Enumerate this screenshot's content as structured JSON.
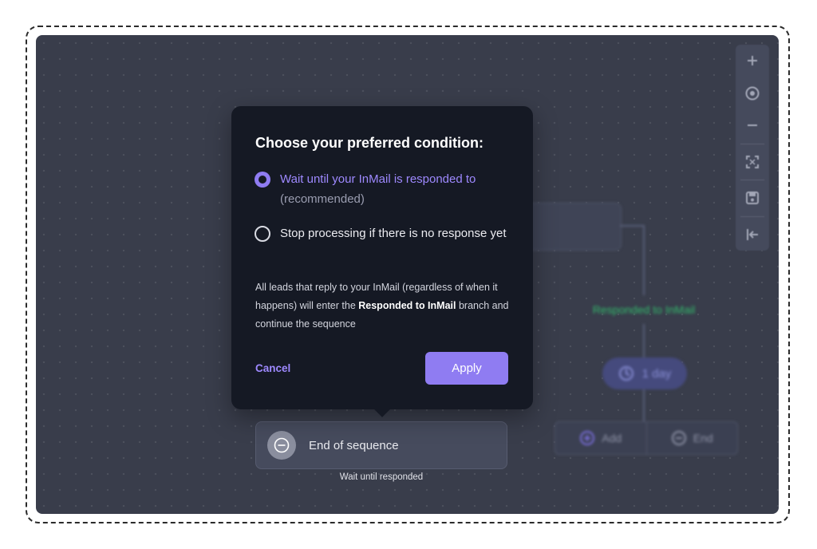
{
  "popover": {
    "title": "Choose your preferred condition:",
    "options": [
      {
        "label": "Wait until your InMail is responded to",
        "sublabel": "(recommended)",
        "selected": true
      },
      {
        "label": "Stop processing if there is no response yet",
        "selected": false
      }
    ],
    "description_pre": "All leads that reply to your InMail (regardless of when it happens) will enter the ",
    "description_bold": "Responded to InMail",
    "description_post": " branch and continue the sequence",
    "cancel_label": "Cancel",
    "apply_label": "Apply"
  },
  "workflow": {
    "end_node_label": "End of sequence",
    "end_node_caption": "Wait until responded",
    "branch_label": "Responded to InMail",
    "delay_label": "1 day",
    "add_label": "Add",
    "end_label": "End"
  },
  "toolbar": {
    "icons": [
      "plus-icon",
      "target-icon",
      "minus-icon",
      "fit-screen-icon",
      "save-icon",
      "exit-icon"
    ]
  },
  "colors": {
    "accent": "#8f7cf2",
    "canvas": "#393d4b",
    "popover": "#151924",
    "branch_green": "#32b96b"
  }
}
